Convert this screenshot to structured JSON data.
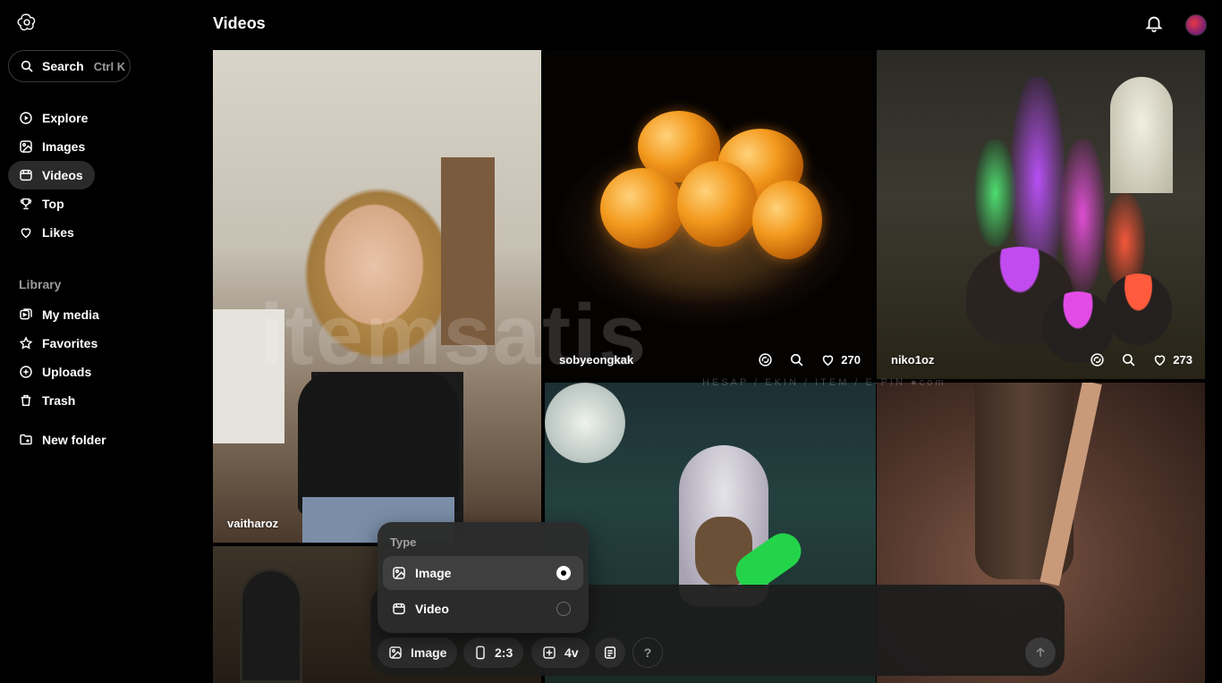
{
  "sidebar": {
    "search": {
      "label": "Search",
      "shortcut": "Ctrl K"
    },
    "nav": [
      {
        "label": "Explore",
        "icon": "compass-icon"
      },
      {
        "label": "Images",
        "icon": "image-icon"
      },
      {
        "label": "Videos",
        "icon": "video-icon",
        "active": true
      },
      {
        "label": "Top",
        "icon": "trophy-icon"
      },
      {
        "label": "Likes",
        "icon": "heart-icon"
      }
    ],
    "library_title": "Library",
    "library": [
      {
        "label": "My media",
        "icon": "media-icon"
      },
      {
        "label": "Favorites",
        "icon": "star-icon"
      },
      {
        "label": "Uploads",
        "icon": "upload-icon"
      },
      {
        "label": "Trash",
        "icon": "trash-icon"
      }
    ],
    "new_folder": "New folder"
  },
  "header": {
    "title": "Videos"
  },
  "grid": [
    {
      "user": "vaitharoz"
    },
    {
      "user": "sobyeongkak",
      "likes": "270"
    },
    {
      "user": "niko1oz",
      "likes": "273"
    }
  ],
  "watermark": {
    "text": "itemsatis",
    "sub": "HESAP / EKIN / ITEM / E-PIN",
    "sub_suffix": "com"
  },
  "popup": {
    "title": "Type",
    "options": [
      {
        "label": "Image",
        "selected": true
      },
      {
        "label": "Video",
        "selected": false
      }
    ]
  },
  "composer": {
    "type_label": "Image",
    "ratio_label": "2:3",
    "variations_label": "4v",
    "help_label": "?"
  },
  "colors": {
    "background": "#000000",
    "active_nav": "#2a2a2a",
    "chip": "#2c2c2c"
  }
}
